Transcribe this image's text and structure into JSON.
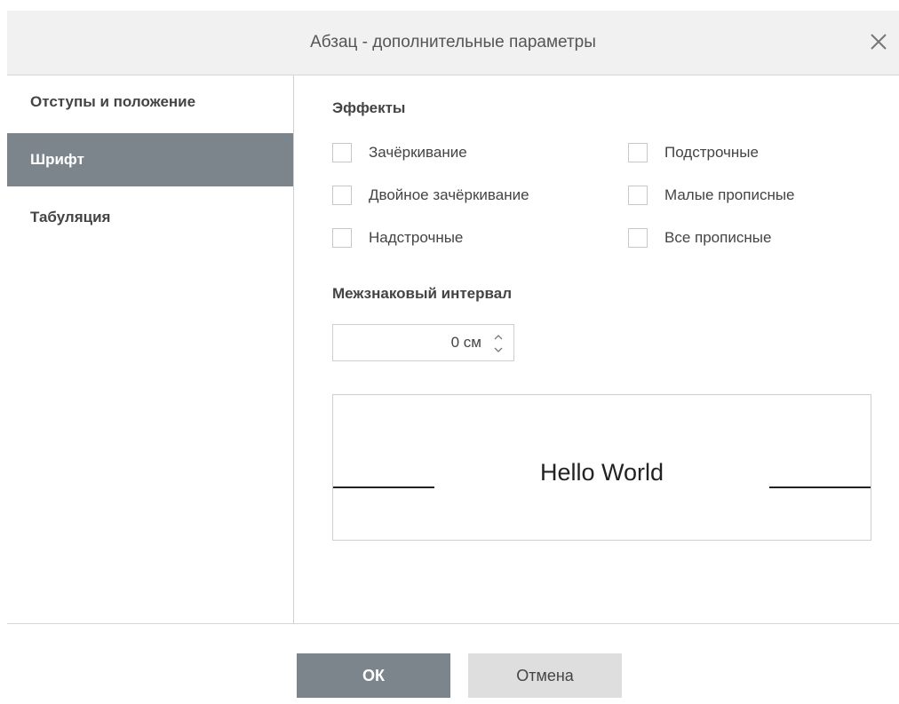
{
  "dialog": {
    "title": "Абзац - дополнительные параметры",
    "close_icon": "close-icon"
  },
  "sidebar": {
    "items": [
      {
        "label": "Отступы и положение",
        "active": false
      },
      {
        "label": "Шрифт",
        "active": true
      },
      {
        "label": "Табуляция",
        "active": false
      }
    ]
  },
  "effects": {
    "heading": "Эффекты",
    "options": [
      {
        "label": "Зачёркивание",
        "checked": false
      },
      {
        "label": "Подстрочные",
        "checked": false
      },
      {
        "label": "Двойное зачёркивание",
        "checked": false
      },
      {
        "label": "Малые прописные",
        "checked": false
      },
      {
        "label": "Надстрочные",
        "checked": false
      },
      {
        "label": "Все прописные",
        "checked": false
      }
    ]
  },
  "spacing": {
    "heading": "Межзнаковый интервал",
    "value": "0 см"
  },
  "preview": {
    "text": "Hello World"
  },
  "footer": {
    "ok_label": "ОК",
    "cancel_label": "Отмена"
  },
  "colors": {
    "active_bg": "#7d858c",
    "header_bg": "#f1f1f1",
    "cancel_bg": "#dedede"
  }
}
